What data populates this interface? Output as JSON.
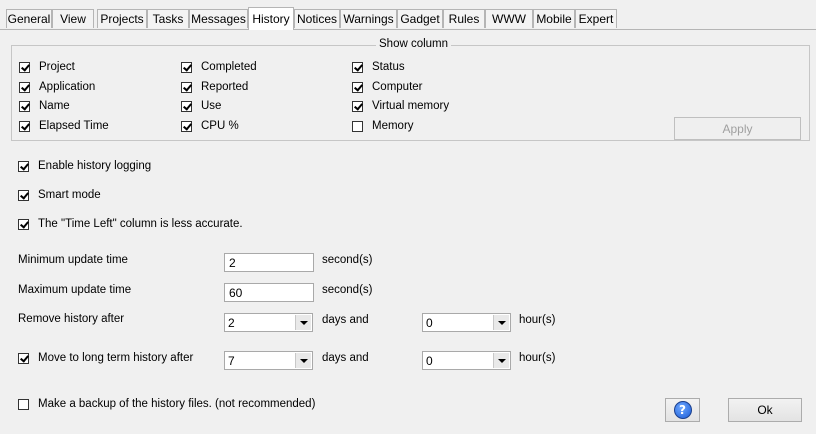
{
  "tabs": [
    {
      "label": "General"
    },
    {
      "label": "View"
    },
    {
      "label": "Projects"
    },
    {
      "label": "Tasks"
    },
    {
      "label": "Messages"
    },
    {
      "label": "History"
    },
    {
      "label": "Notices"
    },
    {
      "label": "Warnings"
    },
    {
      "label": "Gadget"
    },
    {
      "label": "Rules"
    },
    {
      "label": "WWW"
    },
    {
      "label": "Mobile"
    },
    {
      "label": "Expert"
    }
  ],
  "active_tab": "History",
  "show_column": {
    "title": "Show column",
    "items": [
      {
        "label": "Project",
        "checked": true
      },
      {
        "label": "Application",
        "checked": true
      },
      {
        "label": "Name",
        "checked": true
      },
      {
        "label": "Elapsed Time",
        "checked": true
      },
      {
        "label": "Completed",
        "checked": true
      },
      {
        "label": "Reported",
        "checked": true
      },
      {
        "label": "Use",
        "checked": true
      },
      {
        "label": "CPU %",
        "checked": true
      },
      {
        "label": "Status",
        "checked": true
      },
      {
        "label": "Computer",
        "checked": true
      },
      {
        "label": "Virtual memory",
        "checked": true
      },
      {
        "label": "Memory",
        "checked": false
      }
    ],
    "apply_label": "Apply"
  },
  "options": {
    "enable_logging": {
      "label": "Enable history logging",
      "checked": true
    },
    "smart_mode": {
      "label": "Smart mode",
      "checked": true
    },
    "time_left": {
      "label": "The \"Time Left\" column is less accurate.",
      "checked": true
    }
  },
  "min_update": {
    "label": "Minimum update time",
    "value": "2",
    "unit": "second(s)"
  },
  "max_update": {
    "label": "Maximum update time",
    "value": "60",
    "unit": "second(s)"
  },
  "remove_history": {
    "label": "Remove history after",
    "days": "2",
    "days_unit": "days and",
    "hours": "0",
    "hours_unit": "hour(s)"
  },
  "long_term": {
    "label": "Move to long term history after",
    "checked": true,
    "days": "7",
    "days_unit": "days and",
    "hours": "0",
    "hours_unit": "hour(s)"
  },
  "backup": {
    "label": "Make a backup of the history files. (not recommended)",
    "checked": false
  },
  "help_icon": "question-mark",
  "ok_label": "Ok"
}
